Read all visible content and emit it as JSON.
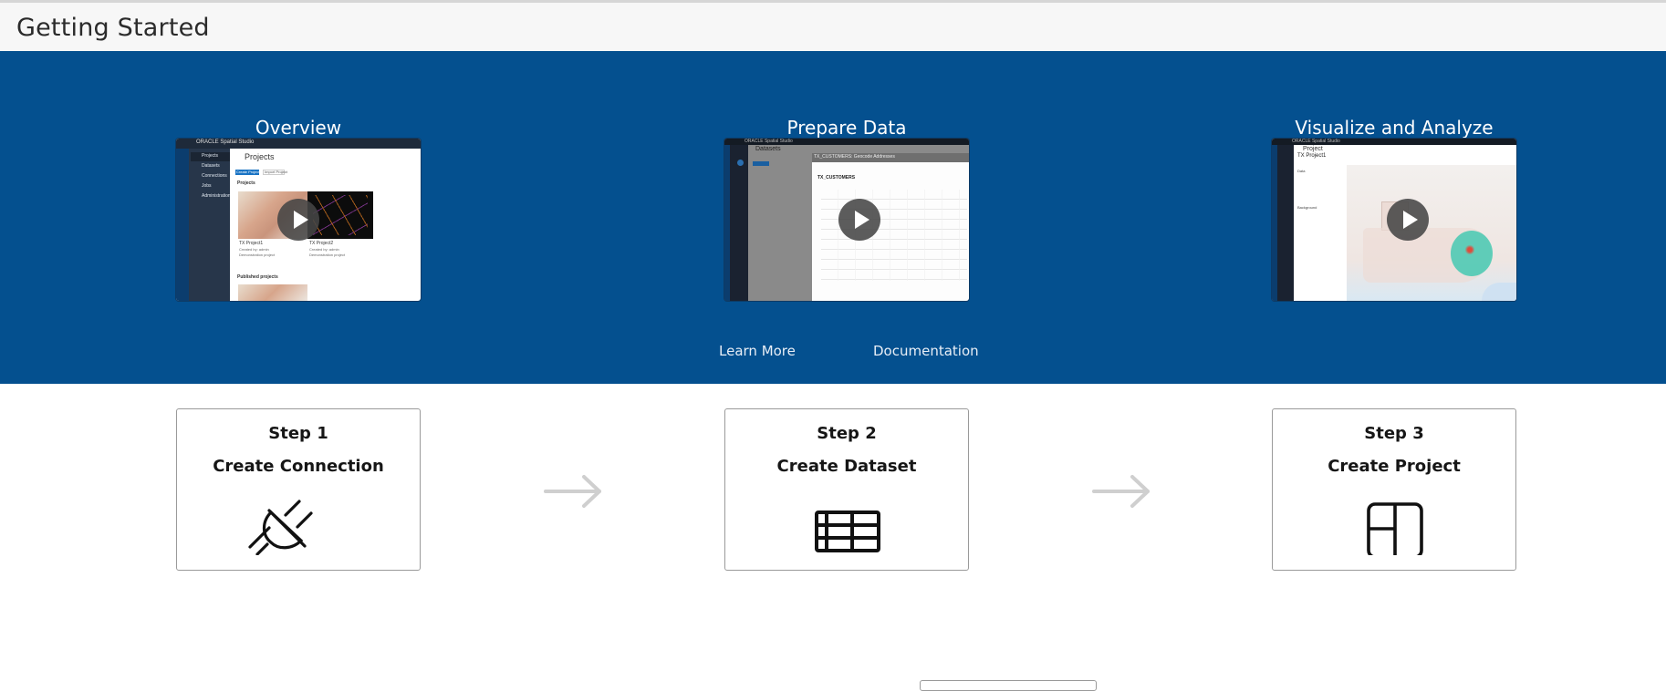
{
  "header": {
    "title": "Getting Started"
  },
  "hero": {
    "background_color": "#04508f",
    "videos": [
      {
        "title": "Overview",
        "thumbnail": {
          "brand": "ORACLE Spatial Studio",
          "page_title": "Projects",
          "nav": [
            "Projects",
            "Datasets",
            "Connections",
            "Jobs",
            "Administration"
          ],
          "buttons": [
            "Create Project",
            "Import Project"
          ],
          "section": "Projects",
          "cards": [
            {
              "name": "TX Project1",
              "created_by": "Created by: admin",
              "desc": "Demonstration project"
            },
            {
              "name": "TX Project2",
              "created_by": "Created by: admin",
              "desc": "Demonstration project"
            }
          ],
          "section2": "Published projects"
        },
        "play_icon": "play-icon"
      },
      {
        "title": "Prepare Data",
        "thumbnail": {
          "brand": "ORACLE Spatial Studio",
          "page_title": "Datasets",
          "button": "Create Dataset",
          "dialog_title": "TX_CUSTOMERS: Geocode Addresses",
          "dialog_heading": "TX_CUSTOMERS"
        },
        "play_icon": "play-icon"
      },
      {
        "title": "Visualize and Analyze",
        "thumbnail": {
          "brand": "ORACLE Spatial Studio",
          "page_title": "Project",
          "project_name": "TX Project1",
          "panel_sections": [
            "Data",
            "Background"
          ]
        },
        "play_icon": "play-icon"
      }
    ],
    "links": [
      {
        "label": "Learn More"
      },
      {
        "label": "Documentation"
      }
    ]
  },
  "steps": [
    {
      "step": "Step 1",
      "title": "Create Connection",
      "icon": "plug-icon"
    },
    {
      "step": "Step 2",
      "title": "Create Dataset",
      "icon": "table-icon"
    },
    {
      "step": "Step 3",
      "title": "Create Project",
      "icon": "layout-icon"
    }
  ],
  "arrows": [
    "arrow-right-icon",
    "arrow-right-icon"
  ]
}
